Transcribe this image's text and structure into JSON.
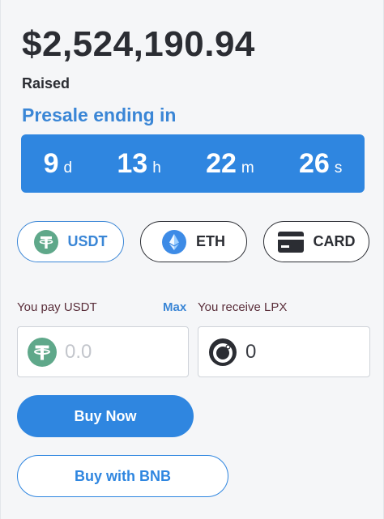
{
  "raised": {
    "amount": "$2,524,190.94",
    "label": "Raised"
  },
  "presale": {
    "title": "Presale ending in"
  },
  "countdown": [
    {
      "value": "9",
      "unit": "d"
    },
    {
      "value": "13",
      "unit": "h"
    },
    {
      "value": "22",
      "unit": "m"
    },
    {
      "value": "26",
      "unit": "s"
    }
  ],
  "payment_methods": [
    {
      "label": "USDT",
      "icon": "tether-icon",
      "selected": true
    },
    {
      "label": "ETH",
      "icon": "ethereum-icon",
      "selected": false
    },
    {
      "label": "CARD",
      "icon": "credit-card-icon",
      "selected": false
    }
  ],
  "form": {
    "pay_label": "You pay USDT",
    "max_label": "Max",
    "receive_label": "You receive LPX",
    "pay_value": "0.0",
    "receive_value": "0"
  },
  "actions": {
    "buy_now": "Buy Now",
    "buy_bnb": "Buy with BNB"
  },
  "colors": {
    "accent": "#2f86e0",
    "tether": "#5fa88a",
    "text": "#2b2d33"
  }
}
